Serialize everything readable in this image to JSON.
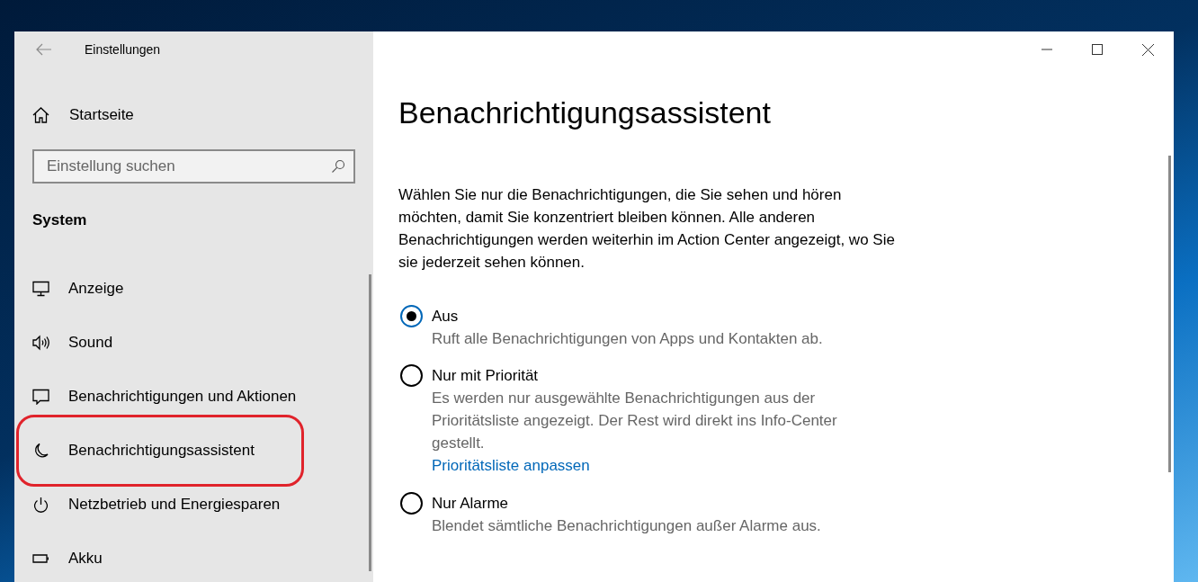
{
  "window": {
    "title": "Einstellungen"
  },
  "sidebar": {
    "home": "Startseite",
    "search": {
      "placeholder": "Einstellung suchen"
    },
    "section": "System",
    "items": [
      {
        "label": "Anzeige",
        "kind": "display",
        "annotated": false
      },
      {
        "label": "Sound",
        "kind": "sound",
        "annotated": false
      },
      {
        "label": "Benachrichtigungen und Aktionen",
        "kind": "message",
        "annotated": false
      },
      {
        "label": "Benachrichtigungsassistent",
        "kind": "moon",
        "annotated": true
      },
      {
        "label": "Netzbetrieb und Energiesparen",
        "kind": "power",
        "annotated": false
      },
      {
        "label": "Akku",
        "kind": "battery",
        "annotated": false
      }
    ]
  },
  "page": {
    "title": "Benachrichtigungsassistent",
    "description": "Wählen Sie nur die Benachrichtigungen, die Sie sehen und hören möchten, damit Sie konzentriert bleiben können. Alle anderen Benachrichtigungen werden weiterhin im Action Center angezeigt, wo Sie sie jederzeit sehen können.",
    "options": [
      {
        "label": "Aus",
        "description": "Ruft alle Benachrichtigungen von Apps und Kontakten ab.",
        "selected": true
      },
      {
        "label": "Nur mit Priorität",
        "description": "Es werden nur ausgewählte Benachrichtigungen aus der Prioritätsliste angezeigt. Der Rest wird direkt ins Info-Center gestellt.",
        "link": "Prioritätsliste anpassen",
        "selected": false
      },
      {
        "label": "Nur Alarme",
        "description": "Blendet sämtliche Benachrichtigungen außer Alarme aus.",
        "selected": false
      }
    ]
  }
}
